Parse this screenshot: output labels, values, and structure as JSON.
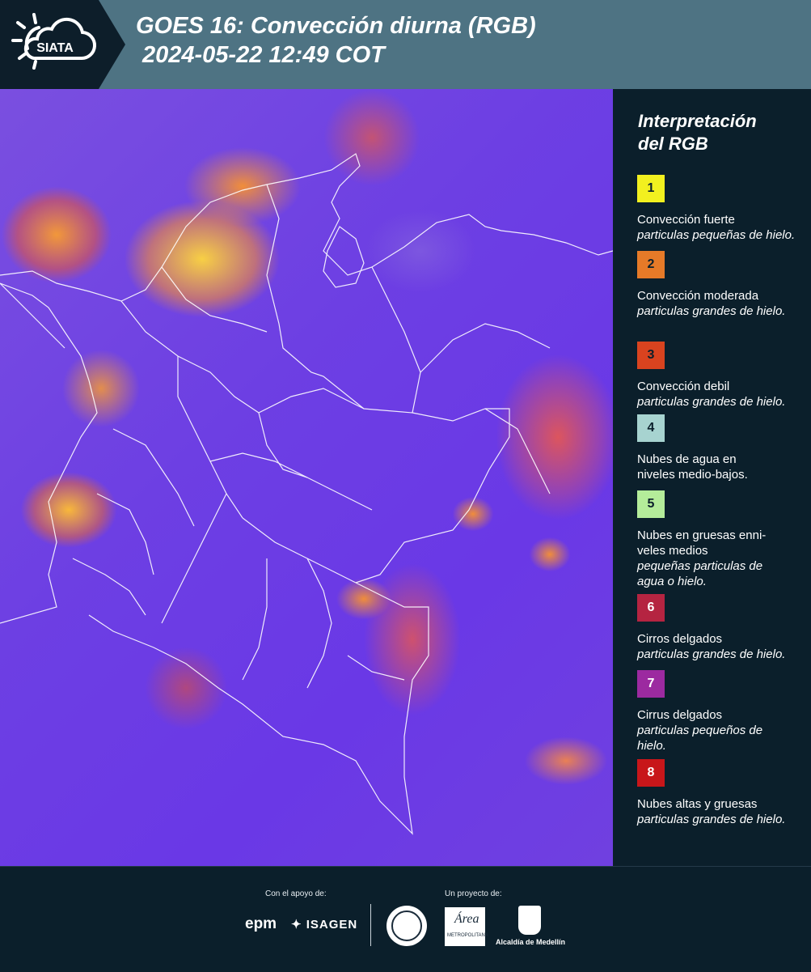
{
  "header": {
    "logo_text": "SIATA",
    "title_line1": "GOES 16: Convección diurna (RGB)",
    "title_line2": "2024-05-22 12:49 COT"
  },
  "legend": {
    "title_line1": "Interpretación",
    "title_line2": "del RGB",
    "items": [
      {
        "number": "1",
        "color": "#f2f01f",
        "label": "Convección fuerte",
        "sub": "particulas pequeñas de hielo."
      },
      {
        "number": "2",
        "color": "#e67a28",
        "label": "Convección moderada",
        "sub": "particulas grandes de hielo."
      },
      {
        "number": "3",
        "color": "#d9431f",
        "label": "Convección debil",
        "sub": "particulas grandes de hielo."
      },
      {
        "number": "4",
        "color": "#a7d3d0",
        "label": "Nubes de agua en niveles medio-bajos.",
        "sub": ""
      },
      {
        "number": "5",
        "color": "#b4ec9a",
        "label": "Nubes en gruesas enni-veles medios",
        "sub": "pequeñas particulas de agua o hielo."
      },
      {
        "number": "6",
        "color": "#b52441",
        "label": "Cirros delgados",
        "sub": "particulas grandes de hielo."
      },
      {
        "number": "7",
        "color": "#9c2aa0",
        "label": "Cirrus delgados",
        "sub": "particulas pequeños de hielo."
      },
      {
        "number": "8",
        "color": "#c8161a",
        "label": "Nubes altas y gruesas",
        "sub": "particulas grandes de hielo."
      }
    ]
  },
  "footer": {
    "support_label": "Con el apoyo de:",
    "project_label": "Un proyecto de:",
    "sponsor1": "epm",
    "sponsor2": "ISAGEN",
    "partner_area": "Área",
    "partner_area_sub": "METROPOLITANA",
    "partner_alcaldia": "Alcaldía de Medellín"
  },
  "colors": {
    "header_bg": "#4e7383",
    "panel_bg": "#0b1f2b"
  }
}
